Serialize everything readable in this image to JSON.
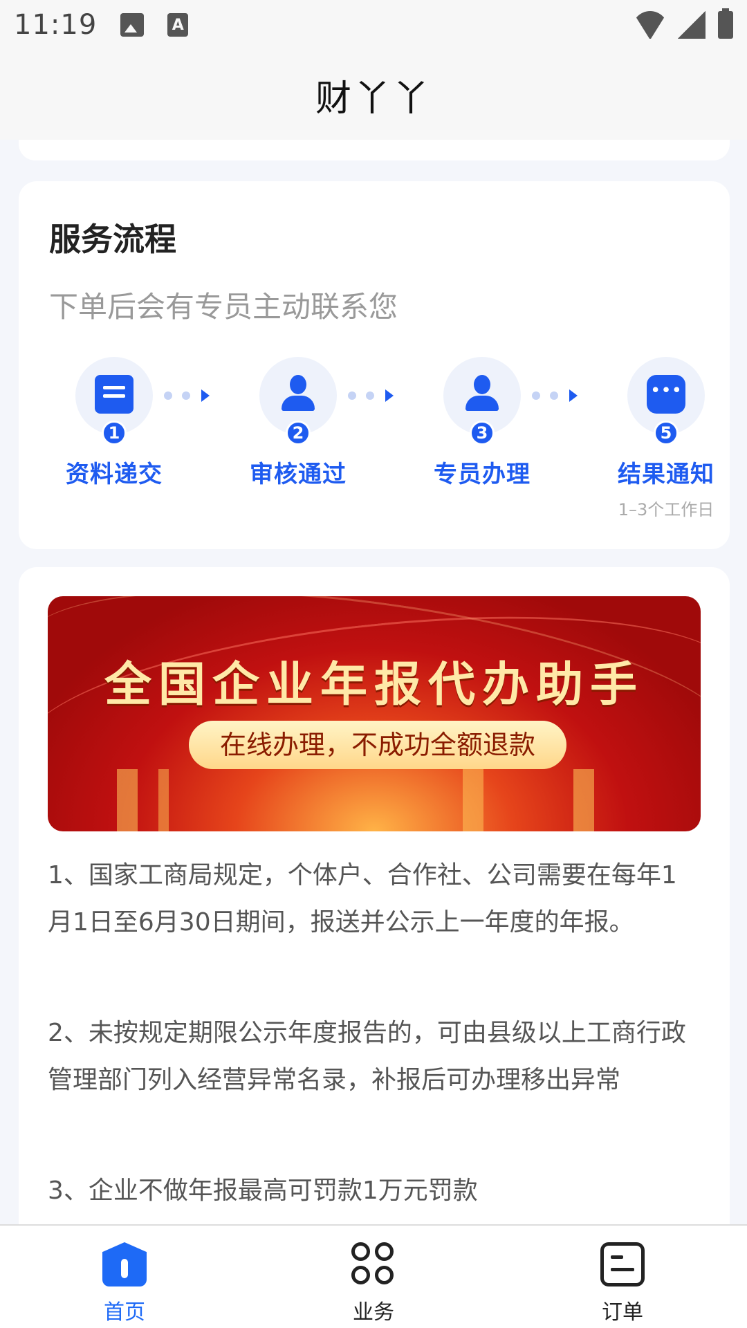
{
  "status_bar": {
    "time": "11:19",
    "icons": [
      "image-icon",
      "text-a-icon",
      "wifi-icon",
      "signal-icon",
      "battery-icon"
    ]
  },
  "header": {
    "title": "财丫丫"
  },
  "process": {
    "title": "服务流程",
    "subtitle": "下单后会有专员主动联系您",
    "steps": [
      {
        "num": "1",
        "label": "资料递交",
        "icon": "document-icon"
      },
      {
        "num": "2",
        "label": "审核通过",
        "icon": "person-icon"
      },
      {
        "num": "3",
        "label": "专员办理",
        "icon": "agent-icon"
      },
      {
        "num": "5",
        "label": "结果通知",
        "icon": "chat-icon",
        "note": "1–3个工作日"
      }
    ]
  },
  "banner": {
    "title": "全国企业年报代办助手",
    "tagline": "在线办理，不成功全额退款"
  },
  "notes": [
    "1、国家工商局规定，个体户、合作社、公司需要在每年1月1日至6月30日期间，报送并公示上一年度的年报。",
    "2、未按规定期限公示年度报告的，可由县级以上工商行政管理部门列入经营异常名录，补报后可办理移出异常",
    "3、企业不做年报最高可罚款1万元罚款"
  ],
  "nav": {
    "items": [
      {
        "label": "首页",
        "icon": "home-icon",
        "active": true
      },
      {
        "label": "业务",
        "icon": "grid-icon",
        "active": false
      },
      {
        "label": "订单",
        "icon": "order-icon",
        "active": false
      }
    ]
  },
  "colors": {
    "accent": "#1e6af6",
    "step_blue": "#1e5bf0",
    "background": "#f4f6fb"
  }
}
